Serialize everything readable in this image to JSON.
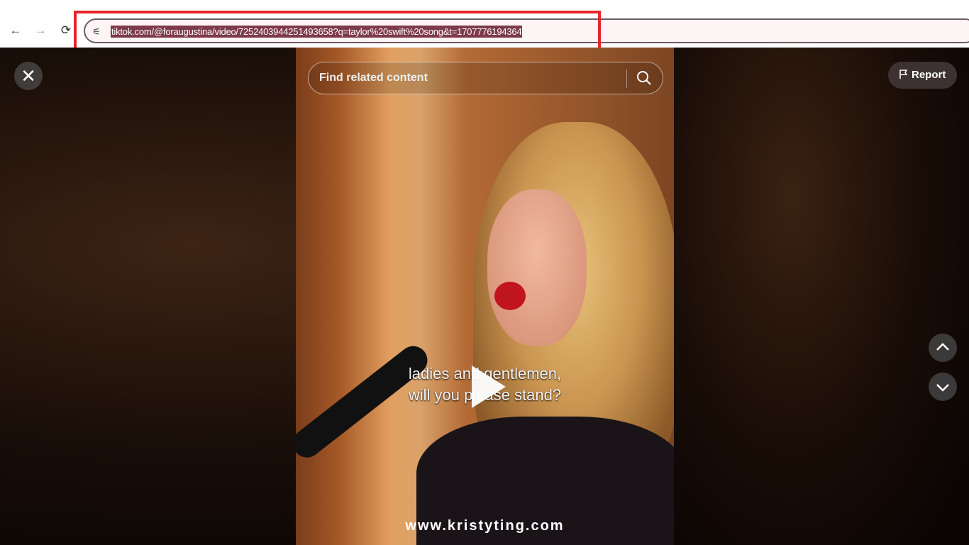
{
  "browser": {
    "url": "tiktok.com/@foraugustina/video/7252403944251493658?q=taylor%20swift%20song&t=1707776194364",
    "back": "←",
    "forward": "→",
    "reload": "⟳",
    "site_settings": "⚟"
  },
  "search": {
    "placeholder": "Find related content"
  },
  "video": {
    "caption_line1": "ladies and gentlemen,",
    "caption_line2": "will you please stand?",
    "watermark": "www.kristyting.com"
  },
  "controls": {
    "close": "✕",
    "report": "Report"
  },
  "colors": {
    "annotation": "#e5252b",
    "url_highlight": "#7d3a4b"
  }
}
